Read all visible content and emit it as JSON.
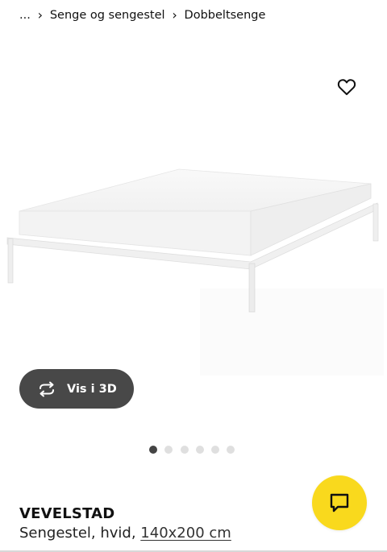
{
  "breadcrumb": {
    "ellipsis": "...",
    "separator": "›",
    "items": [
      "Senge og sengestel",
      "Dobbeltsenge"
    ]
  },
  "gallery": {
    "view3d_label": "Vis i 3D",
    "dot_count": 6,
    "active_dot": 1
  },
  "product": {
    "name": "VEVELSTAD",
    "description": "Sengestel, hvid, ",
    "size": "140x200 cm"
  },
  "icons": {
    "favorite": "heart-icon",
    "rotate": "rotate-3d-icon",
    "chat": "chat-icon"
  },
  "colors": {
    "chat_button": "#f9d91d",
    "view3d_button": "#484848",
    "dot_active": "#444444",
    "dot_inactive": "#dfdfdf"
  }
}
